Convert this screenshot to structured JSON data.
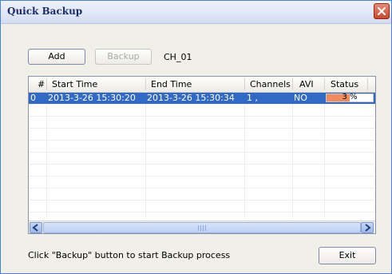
{
  "window": {
    "title": "Quick Backup"
  },
  "toolbar": {
    "add_label": "Add",
    "backup_label": "Backup",
    "channel": "CH_01"
  },
  "table": {
    "columns": [
      "#",
      "Start Time",
      "End Time",
      "Channels",
      "AVI",
      "Status"
    ],
    "rows": [
      {
        "index": "0",
        "start": "2013-3-26 15:30:20",
        "end": "2013-3-26 15:30:34",
        "channels": "1 ,",
        "avi": "NO",
        "status": "3 %",
        "progress": 0.5
      }
    ]
  },
  "footer": {
    "message": "Click \"Backup\" button to start Backup process",
    "exit_label": "Exit"
  },
  "colors": {
    "selection": "#316ac5",
    "progress": "#f28b5b",
    "close": "#c8462a"
  },
  "icons": {
    "close": "close-icon",
    "scroll_left": "chevron-left-icon",
    "scroll_right": "chevron-right-icon"
  }
}
